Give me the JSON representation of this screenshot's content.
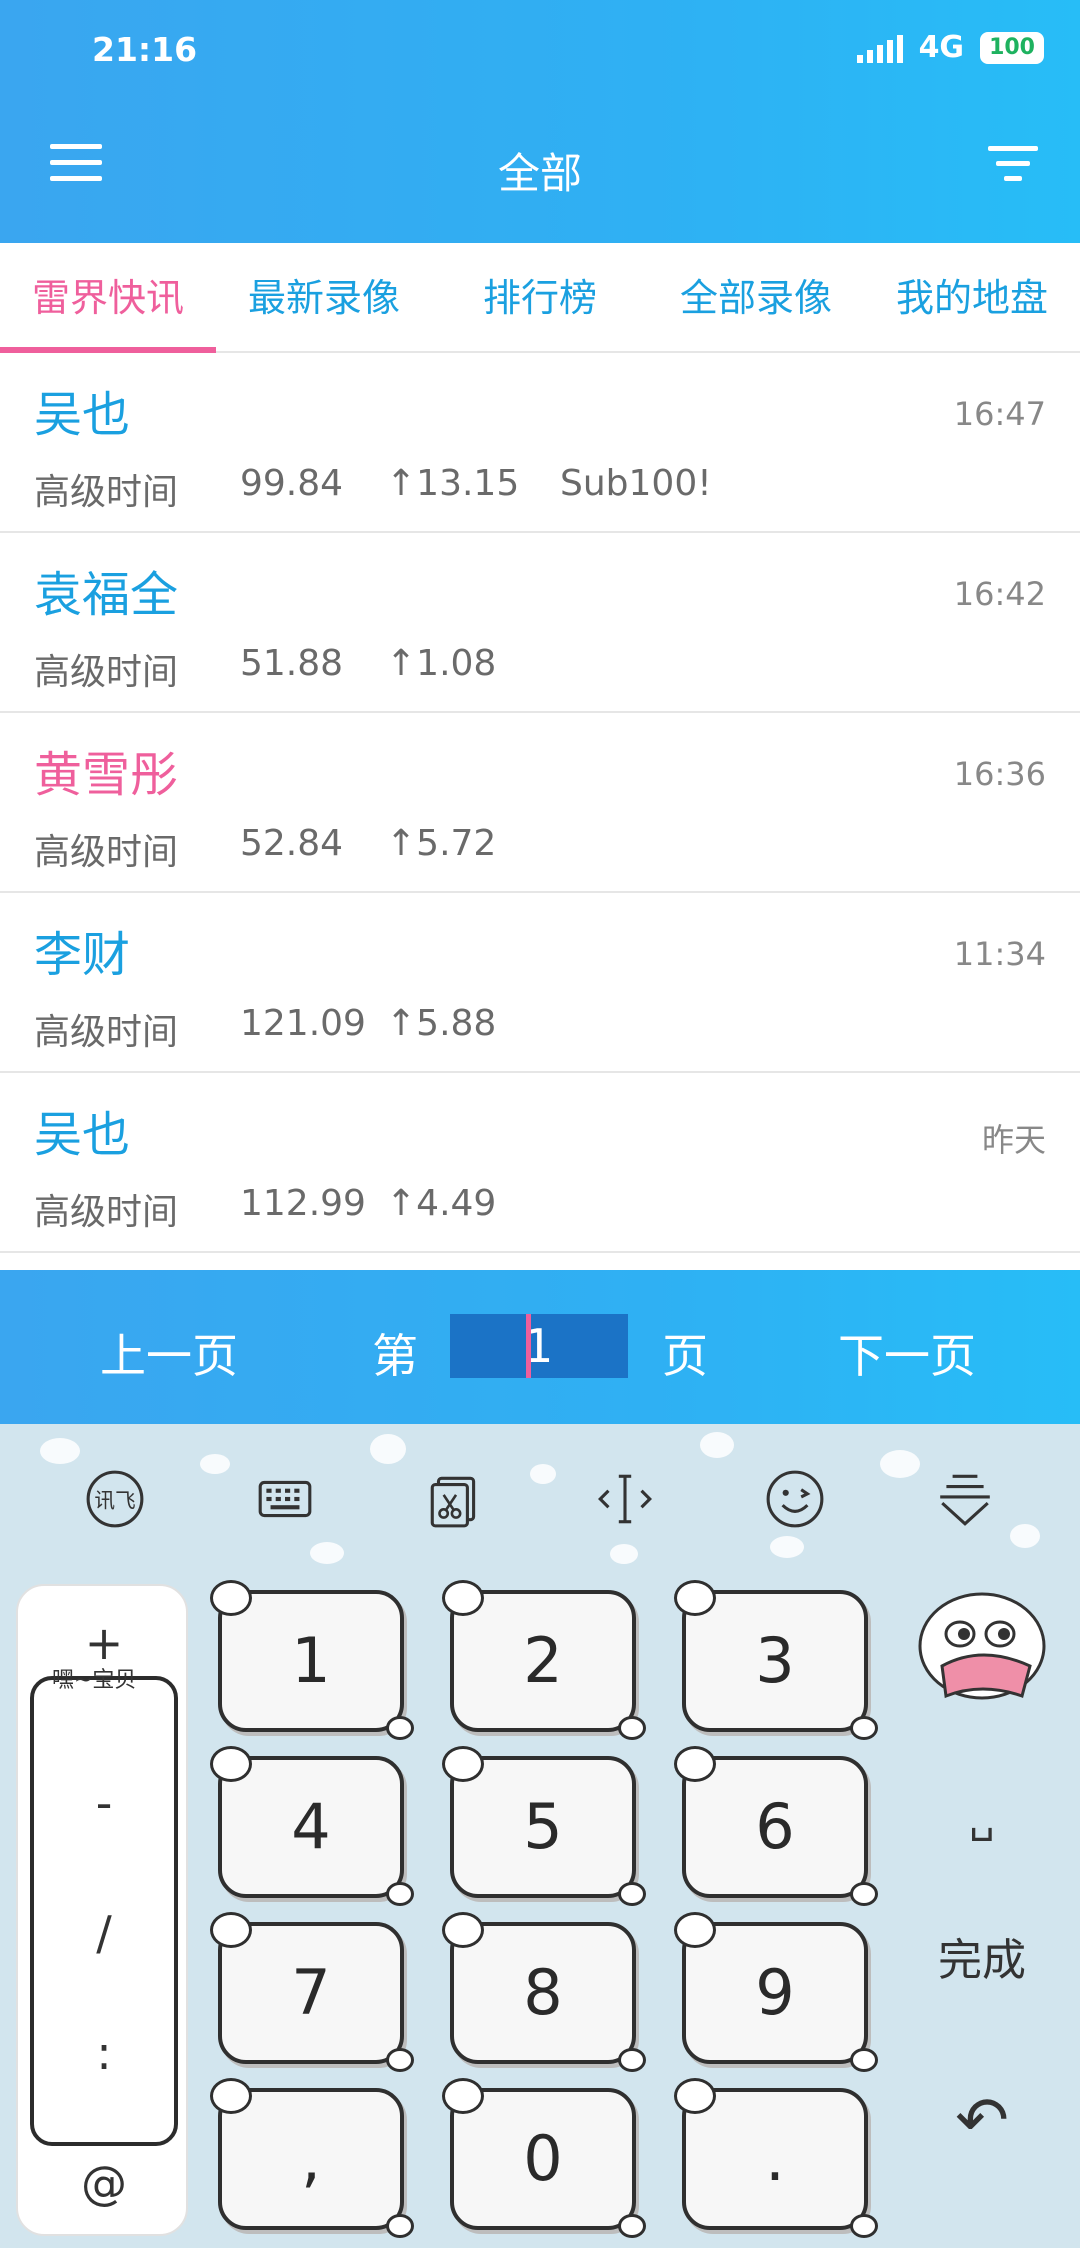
{
  "status_bar": {
    "time": "21:16",
    "network": "4G",
    "battery": "100"
  },
  "app_bar": {
    "title": "全部"
  },
  "tabs": [
    {
      "label": "雷界快讯",
      "active": true
    },
    {
      "label": "最新录像",
      "active": false
    },
    {
      "label": "排行榜",
      "active": false
    },
    {
      "label": "全部录像",
      "active": false
    },
    {
      "label": "我的地盘",
      "active": false
    }
  ],
  "items": [
    {
      "name": "吴也",
      "time": "16:47",
      "label": "高级时间",
      "value": "99.84",
      "delta": "↑13.15",
      "note": "Sub100!",
      "highlight": false
    },
    {
      "name": "袁福全",
      "time": "16:42",
      "label": "高级时间",
      "value": "51.88",
      "delta": "↑1.08",
      "note": "",
      "highlight": false
    },
    {
      "name": "黄雪彤",
      "time": "16:36",
      "label": "高级时间",
      "value": "52.84",
      "delta": "↑5.72",
      "note": "",
      "highlight": true
    },
    {
      "name": "李财",
      "time": "11:34",
      "label": "高级时间",
      "value": "121.09",
      "delta": "↑5.88",
      "note": "",
      "highlight": false
    },
    {
      "name": "吴也",
      "time": "昨天",
      "label": "高级时间",
      "value": "112.99",
      "delta": "↑4.49",
      "note": "",
      "highlight": false
    }
  ],
  "pager": {
    "prev": "上一页",
    "page_prefix": "第",
    "page_value": "1",
    "page_suffix": "页",
    "next": "下一页"
  },
  "keyboard": {
    "toolbar_icons": [
      "iflytek-logo-icon",
      "keyboard-icon",
      "clipboard-scissors-icon",
      "cursor-move-icon",
      "emoji-wink-icon",
      "hide-keyboard-icon"
    ],
    "side_caption": "嘿~宝贝",
    "side_keys": [
      "+",
      "-",
      "/",
      ":",
      "@"
    ],
    "keys": [
      "1",
      "2",
      "3",
      "4",
      "5",
      "6",
      "7",
      "8",
      "9",
      ",",
      "0",
      "."
    ],
    "space_label": "␣",
    "done_label": "完成",
    "backspace_label": "↶"
  },
  "colors": {
    "accent_blue": "#2fb0f3",
    "link_blue": "#1aa0e0",
    "pink": "#ef5f9c"
  }
}
